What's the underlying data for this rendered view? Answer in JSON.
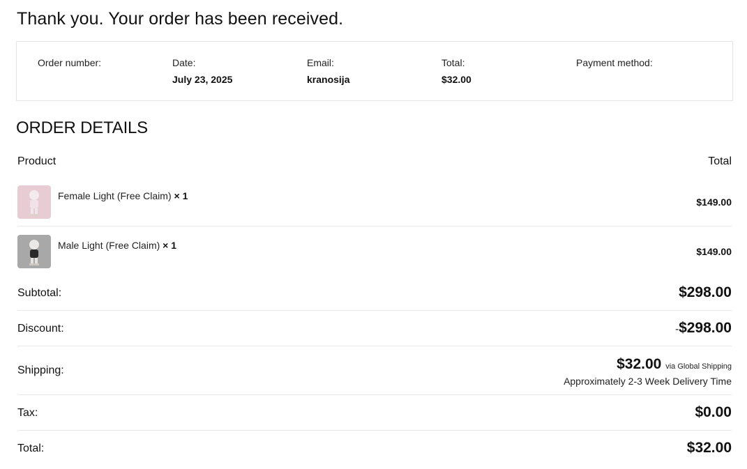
{
  "heading": "Thank you. Your order has been received.",
  "overview": {
    "order_number_label": "Order number:",
    "order_number_value": "",
    "date_label": "Date:",
    "date_value": "July 23, 2025",
    "email_label": "Email:",
    "email_value": "kranosija",
    "total_label": "Total:",
    "total_value": "$32.00",
    "payment_label": "Payment method:",
    "payment_value": ""
  },
  "details_title": "ORDER DETAILS",
  "table": {
    "product_header": "Product",
    "total_header": "Total"
  },
  "items": [
    {
      "name": "Female Light (Free Claim)",
      "qty": "× 1",
      "total": "$149.00",
      "thumb_bg": "#e8ccd4",
      "thumb_figure": "#f0e2e8"
    },
    {
      "name": "Male Light (Free Claim)",
      "qty": "× 1",
      "total": "$149.00",
      "thumb_bg": "#a8a8a8",
      "thumb_figure": "#2a2a2a"
    }
  ],
  "totals": {
    "subtotal_label": "Subtotal:",
    "subtotal_value": "$298.00",
    "discount_label": "Discount:",
    "discount_sign": "-",
    "discount_value": "$298.00",
    "shipping_label": "Shipping:",
    "shipping_value": "$32.00",
    "shipping_via": "via Global Shipping",
    "shipping_note": "Approximately 2-3 Week Delivery Time",
    "tax_label": "Tax:",
    "tax_value": "$0.00",
    "total_label": "Total:",
    "total_value": "$32.00"
  }
}
